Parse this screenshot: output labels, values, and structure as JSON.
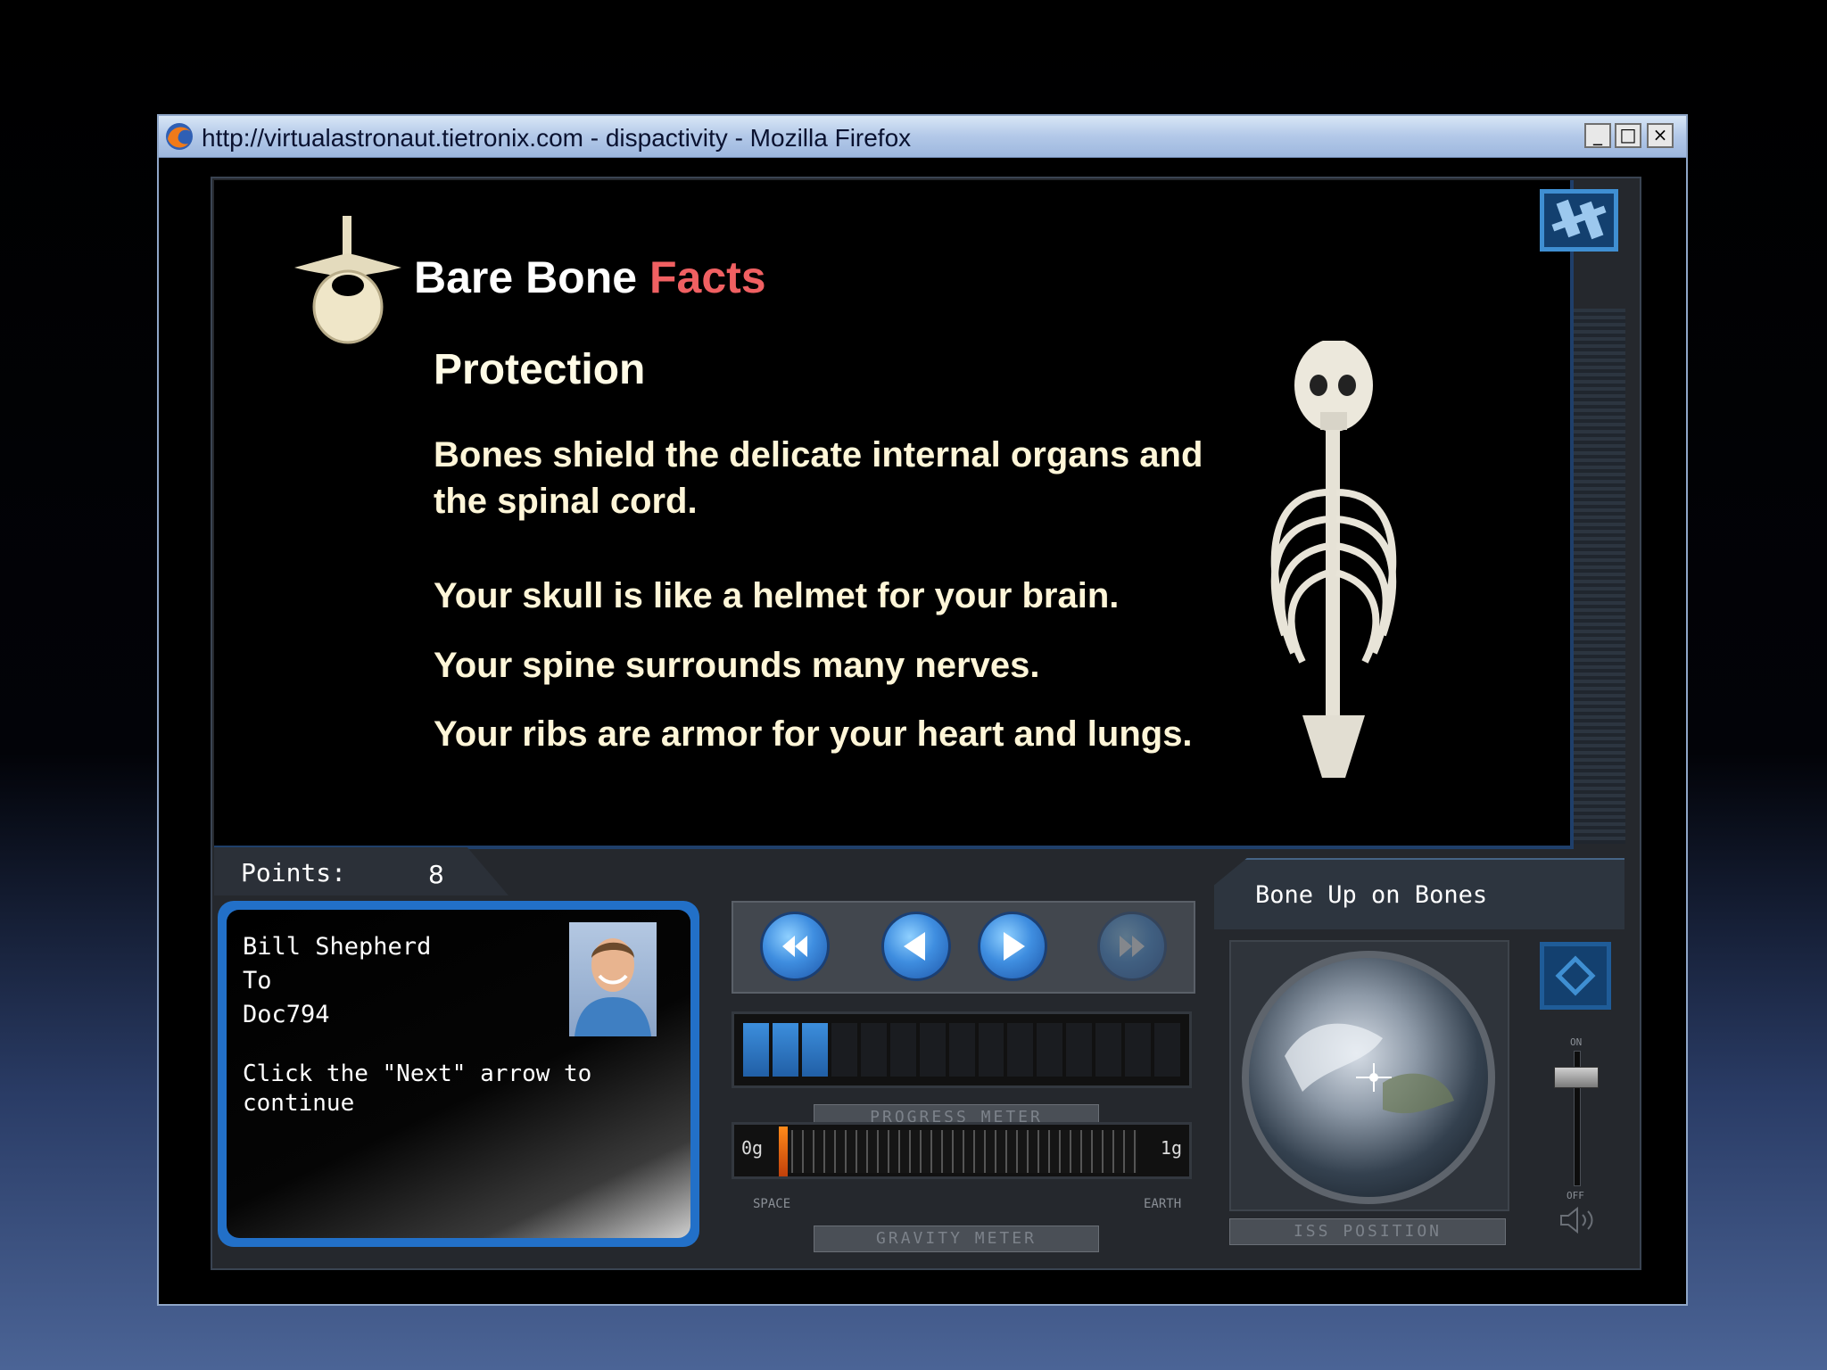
{
  "window": {
    "title": "http://virtualastronaut.tietronix.com - dispactivity - Mozilla Firefox",
    "min_glyph": "_",
    "max_glyph": "□",
    "close_glyph": "×"
  },
  "slide": {
    "heading_main": "Bare Bone",
    "heading_accent": "Facts",
    "subheading": "Protection",
    "facts": [
      "Bones shield the delicate internal organs and the spinal cord.",
      "Your skull is like a helmet for your brain.",
      "Your spine surrounds many nerves.",
      "Your ribs are armor for your heart and lungs."
    ]
  },
  "points": {
    "label": "Points:",
    "value": "8"
  },
  "lesson": {
    "title": "Bone Up on Bones"
  },
  "message": {
    "from": "Bill Shepherd",
    "to_label": "To",
    "recipient": "Doc794",
    "body": "Click the \"Next\" arrow to continue"
  },
  "meters": {
    "progress_label": "PROGRESS METER",
    "progress_segments_total": 15,
    "progress_segments_filled": 3,
    "gravity_label": "GRAVITY METER",
    "gravity_min": "0g",
    "gravity_max": "1g",
    "gravity_left_caption": "SPACE",
    "gravity_right_caption": "EARTH",
    "gravity_value": 0
  },
  "iss": {
    "label": "ISS POSITION"
  },
  "volume": {
    "on_label": "ON",
    "off_label": "OFF"
  },
  "colors": {
    "accent_red": "#f06062",
    "accent_blue": "#2270c8",
    "progress_fill": "#3c8edc"
  },
  "icons": {
    "rewind": "rewind-icon",
    "back": "previous-arrow-icon",
    "next": "next-arrow-icon",
    "fast_forward": "fast-forward-icon",
    "home": "space-station-icon",
    "settings": "diamond-icon",
    "volume": "speaker-icon"
  }
}
